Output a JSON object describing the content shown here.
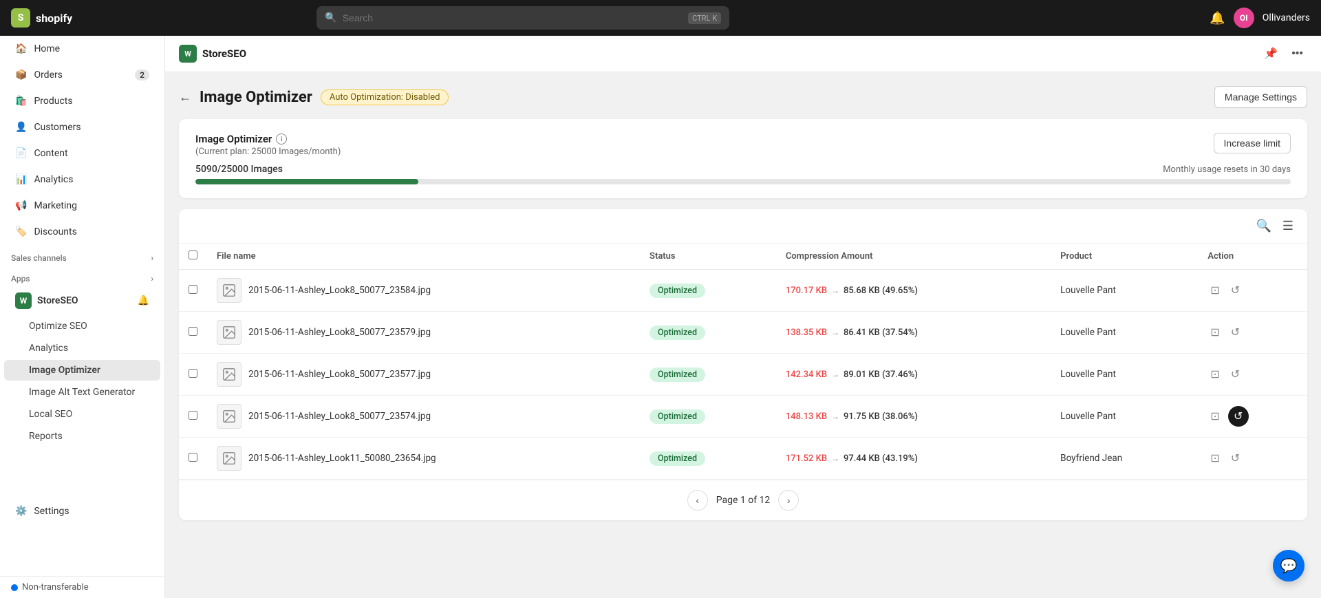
{
  "topNav": {
    "logo": "S",
    "brandName": "shopify",
    "search": {
      "placeholder": "Search",
      "shortcut1": "CTRL",
      "shortcut2": "K"
    },
    "avatar": "OI",
    "storeName": "Ollivanders"
  },
  "sidebar": {
    "items": [
      {
        "id": "home",
        "label": "Home",
        "icon": "🏠",
        "badge": null
      },
      {
        "id": "orders",
        "label": "Orders",
        "icon": "📦",
        "badge": "2"
      },
      {
        "id": "products",
        "label": "Products",
        "icon": "🛍️",
        "badge": null
      },
      {
        "id": "customers",
        "label": "Customers",
        "icon": "👤",
        "badge": null
      },
      {
        "id": "content",
        "label": "Content",
        "icon": "📄",
        "badge": null
      },
      {
        "id": "analytics",
        "label": "Analytics",
        "icon": "📊",
        "badge": null
      },
      {
        "id": "marketing",
        "label": "Marketing",
        "icon": "📢",
        "badge": null
      },
      {
        "id": "discounts",
        "label": "Discounts",
        "icon": "🏷️",
        "badge": null
      }
    ],
    "salesChannelsLabel": "Sales channels",
    "appsLabel": "Apps",
    "storeSeoApp": {
      "icon": "W",
      "name": "StoreSEO"
    },
    "subItems": [
      {
        "id": "optimize-seo",
        "label": "Optimize SEO"
      },
      {
        "id": "analytics",
        "label": "Analytics"
      },
      {
        "id": "image-optimizer",
        "label": "Image Optimizer",
        "active": true
      },
      {
        "id": "image-alt-text",
        "label": "Image Alt Text Generator"
      },
      {
        "id": "local-seo",
        "label": "Local SEO"
      },
      {
        "id": "reports",
        "label": "Reports"
      }
    ],
    "settings": "Settings",
    "nonTransferable": "Non-transferable"
  },
  "appHeader": {
    "logo": "W",
    "name": "StoreSEO",
    "pinLabel": "pin",
    "moreLabel": "more"
  },
  "page": {
    "backLabel": "←",
    "title": "Image Optimizer",
    "autoBadge": "Auto Optimization: Disabled",
    "manageSettings": "Manage Settings"
  },
  "usage": {
    "title": "Image Optimizer",
    "infoIcon": "i",
    "plan": "(Current plan: 25000 Images/month)",
    "count": "5090/25000 Images",
    "resetText": "Monthly usage resets in 30 days",
    "progressPct": 20.36,
    "increaseBtn": "Increase limit"
  },
  "table": {
    "columns": [
      "File name",
      "Status",
      "Compression Amount",
      "Product",
      "Action"
    ],
    "rows": [
      {
        "filename": "2015-06-11-Ashley_Look8_50077_23584.jpg",
        "status": "Optimized",
        "origSize": "170.17 KB",
        "newSize": "85.68 KB (49.65%)",
        "product": "Louvelle Pant",
        "imgColor": "#f0f0f0"
      },
      {
        "filename": "2015-06-11-Ashley_Look8_50077_23579.jpg",
        "status": "Optimized",
        "origSize": "138.35 KB",
        "newSize": "86.41 KB (37.54%)",
        "product": "Louvelle Pant",
        "imgColor": "#f0f0f0"
      },
      {
        "filename": "2015-06-11-Ashley_Look8_50077_23577.jpg",
        "status": "Optimized",
        "origSize": "142.34 KB",
        "newSize": "89.01 KB (37.46%)",
        "product": "Louvelle Pant",
        "imgColor": "#f0f0f0"
      },
      {
        "filename": "2015-06-11-Ashley_Look8_50077_23574.jpg",
        "status": "Optimized",
        "origSize": "148.13 KB",
        "newSize": "91.75 KB (38.06%)",
        "product": "Louvelle Pant",
        "imgColor": "#f0f0f0"
      },
      {
        "filename": "2015-06-11-Ashley_Look11_50080_23654.jpg",
        "status": "Optimized",
        "origSize": "171.52 KB",
        "newSize": "97.44 KB (43.19%)",
        "product": "Boyfriend Jean",
        "imgColor": "#f0f0f0"
      }
    ],
    "pagination": {
      "page": 1,
      "total": 12,
      "label": "Page 1 of 12"
    }
  }
}
